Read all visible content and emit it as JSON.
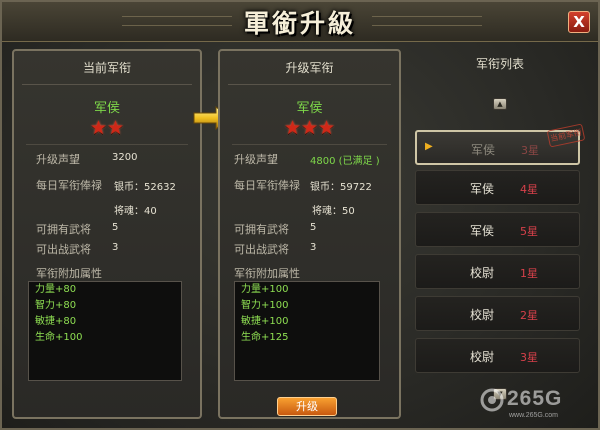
{
  "window": {
    "title": "軍銜升級",
    "close_label": "X"
  },
  "current_panel": {
    "header": "当前军衔",
    "rank_name": "军侯",
    "stars": 2,
    "star_glyphs": "★★",
    "prestige_label": "升级声望",
    "prestige_value": "3200",
    "salary_label": "每日军衔俸禄",
    "silver_value": "银币：52632",
    "soul_value": "将魂：40",
    "generals_owned_label": "可拥有武将",
    "generals_owned_value": "5",
    "generals_battle_label": "可出战武将",
    "generals_battle_value": "3",
    "attributes_title": "军衔附加属性",
    "attributes": [
      "力量+80",
      "智力+80",
      "敏捷+80",
      "生命+100"
    ]
  },
  "next_panel": {
    "header": "升级军衔",
    "rank_name": "军侯",
    "stars": 3,
    "star_glyphs": "★★★",
    "prestige_label": "升级声望",
    "prestige_value": "4800 (已满足 )",
    "salary_label": "每日军衔俸禄",
    "silver_value": "银币：59722",
    "soul_value": "将魂：50",
    "generals_owned_label": "可拥有武将",
    "generals_owned_value": "5",
    "generals_battle_label": "可出战武将",
    "generals_battle_value": "3",
    "attributes_title": "军衔附加属性",
    "attributes": [
      "力量+100",
      "智力+100",
      "敏捷+100",
      "生命+125"
    ]
  },
  "upgrade_button_label": "升级",
  "rank_list": {
    "title": "军衔列表",
    "items": [
      {
        "name": "军侯",
        "stars": "3星",
        "selected": true,
        "stamp": "当前军衔"
      },
      {
        "name": "军侯",
        "stars": "4星",
        "selected": false
      },
      {
        "name": "军侯",
        "stars": "5星",
        "selected": false
      },
      {
        "name": "校尉",
        "stars": "1星",
        "selected": false
      },
      {
        "name": "校尉",
        "stars": "2星",
        "selected": false
      },
      {
        "name": "校尉",
        "stars": "3星",
        "selected": false
      }
    ]
  },
  "watermark": {
    "brand": "265G",
    "url": "www.265G.com"
  },
  "colors": {
    "accent_green": "#7ed84a",
    "star_red": "#d02818",
    "button_orange": "#e07a20",
    "frame_border": "#7a7360"
  }
}
